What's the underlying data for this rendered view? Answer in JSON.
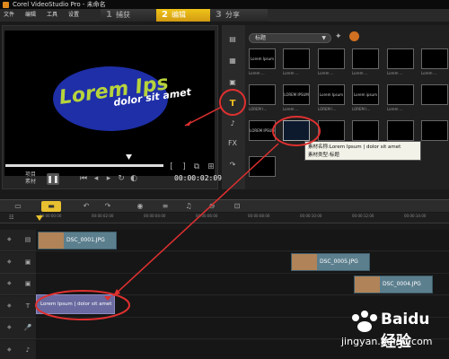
{
  "window": {
    "title": "Corel VideoStudio Pro - 未命名"
  },
  "menu": {
    "items": [
      "文件",
      "编辑",
      "工具",
      "设置"
    ]
  },
  "steps": [
    {
      "num": "1",
      "label": "捕获"
    },
    {
      "num": "2",
      "label": "编辑"
    },
    {
      "num": "3",
      "label": "分享"
    }
  ],
  "preview": {
    "title_line1": "Lorem Ips",
    "title_line2": "dolor sit amet",
    "mode_labels": [
      "项目",
      "素材"
    ],
    "timecode": "00:00:02:09",
    "scrub_progress": 0.6
  },
  "library": {
    "category": "标题",
    "thumb_labels": [
      "Lorem ...",
      "Lorem ...",
      "Lorem ...",
      "Lorem ...",
      "Lorem ...",
      "Lorem ...",
      "LOREM I...",
      "Lorem ...",
      "LOREM I...",
      "LOREM I...",
      "Lorem ..."
    ],
    "thumb_texts": [
      "Lorem Ipsum",
      "LOREM IPSUM",
      "Lorem Ipsum",
      "Lorem ipsum",
      "LOREM IPSUM"
    ],
    "tooltip_line1": "素材名称:Lorem Ipsum |  dolor sit amet",
    "tooltip_line2": "素材类型:标题"
  },
  "timeline": {
    "ruler_ticks": [
      "00:00:00:00",
      "00:00:02:00",
      "00:00:04:00",
      "00:00:06:00",
      "00:00:08:00",
      "00:00:10:00",
      "00:00:12:00",
      "00:00:14:00"
    ],
    "clips": [
      {
        "name": "DSC_0001.JPG"
      },
      {
        "name": "DSC_0005.JPG"
      },
      {
        "name": "DSC_0004.JPG"
      }
    ],
    "title_clip": "Lorem Ipsum | dolor sit amet"
  },
  "watermark": {
    "brand": "Baidu 经验",
    "url": "jingyan.baidu.com"
  },
  "colors": {
    "accent": "#e8c030",
    "annotation_red": "#e03030",
    "clip_blue": "#5c7f8e",
    "title_clip": "#6a6aa0"
  }
}
